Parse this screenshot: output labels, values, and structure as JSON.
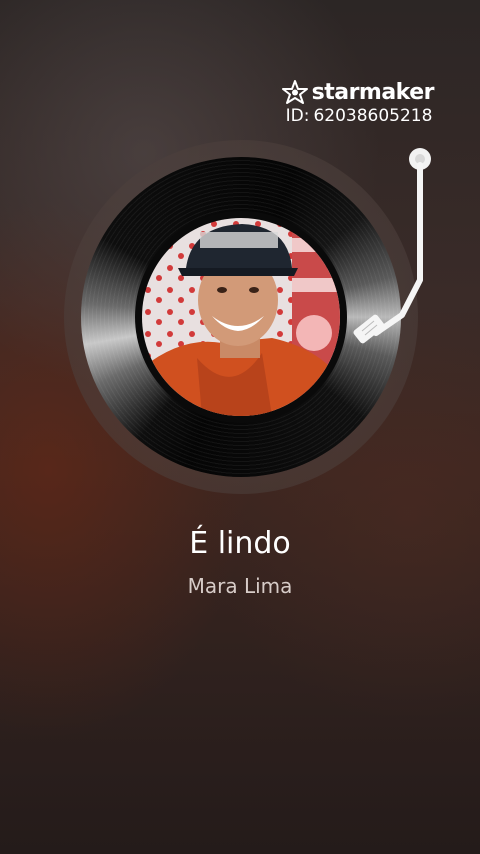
{
  "watermark": {
    "brand": "starmaker",
    "id_label": "ID:",
    "id_value": "62038605218",
    "icon": "starmaker-logo-icon"
  },
  "song": {
    "title": "É lindo",
    "artist": "Mara Lima"
  },
  "player": {
    "record_icon": "vinyl-record-icon",
    "tonearm_icon": "tonearm-icon"
  }
}
